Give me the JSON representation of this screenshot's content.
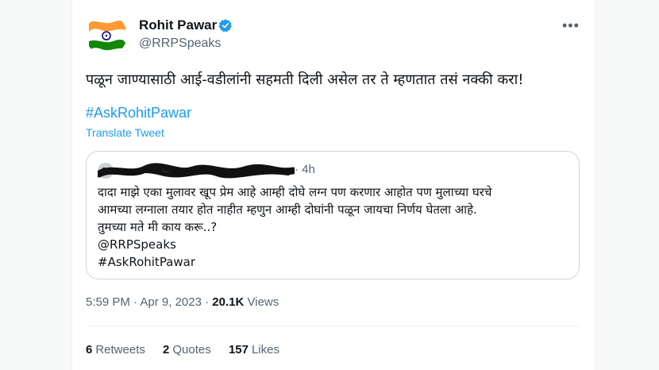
{
  "colors": {
    "accent": "#1d9bf0",
    "text": "#0f1419",
    "muted": "#536471",
    "flag_saffron": "#ff9933",
    "flag_green": "#138808",
    "flag_chakra": "#000080"
  },
  "author": {
    "display_name": "Rohit Pawar",
    "handle": "@RRPSpeaks",
    "avatar_icon": "india-flag-icon",
    "verified_icon": "verified-badge-icon"
  },
  "more_icon": "more-options-icon",
  "tweet": {
    "text": "पळून जाण्यासाठी आई-वडीलांनी सहमती दिली असेल तर ते म्हणतात तसं नक्की करा!",
    "hashtag": "#AskRohitPawar",
    "translate_label": "Translate Tweet"
  },
  "quoted": {
    "time": "· 4h",
    "lines": [
      "दादा माझे एका मुलावर खूप प्रेम आहे आम्ही दोघे लग्न पण करणार आहोत पण मुलाच्या घरचे",
      "आमच्या लग्नाला तयार होत नाहीत म्हणुन आम्ही दोघांनी पळून जायचा निर्णय घेतला आहे.",
      "तुमच्या मते मी काय करू..?",
      "@RRPSpeaks",
      "#AskRohitPawar"
    ]
  },
  "meta": {
    "time": "5:59 PM",
    "separator": "·",
    "date": "Apr 9, 2023",
    "separator2": "·",
    "views_count": "20.1K",
    "views_label": "Views"
  },
  "stats": {
    "retweets_count": "6",
    "retweets_label": "Retweets",
    "quotes_count": "2",
    "quotes_label": "Quotes",
    "likes_count": "157",
    "likes_label": "Likes"
  }
}
